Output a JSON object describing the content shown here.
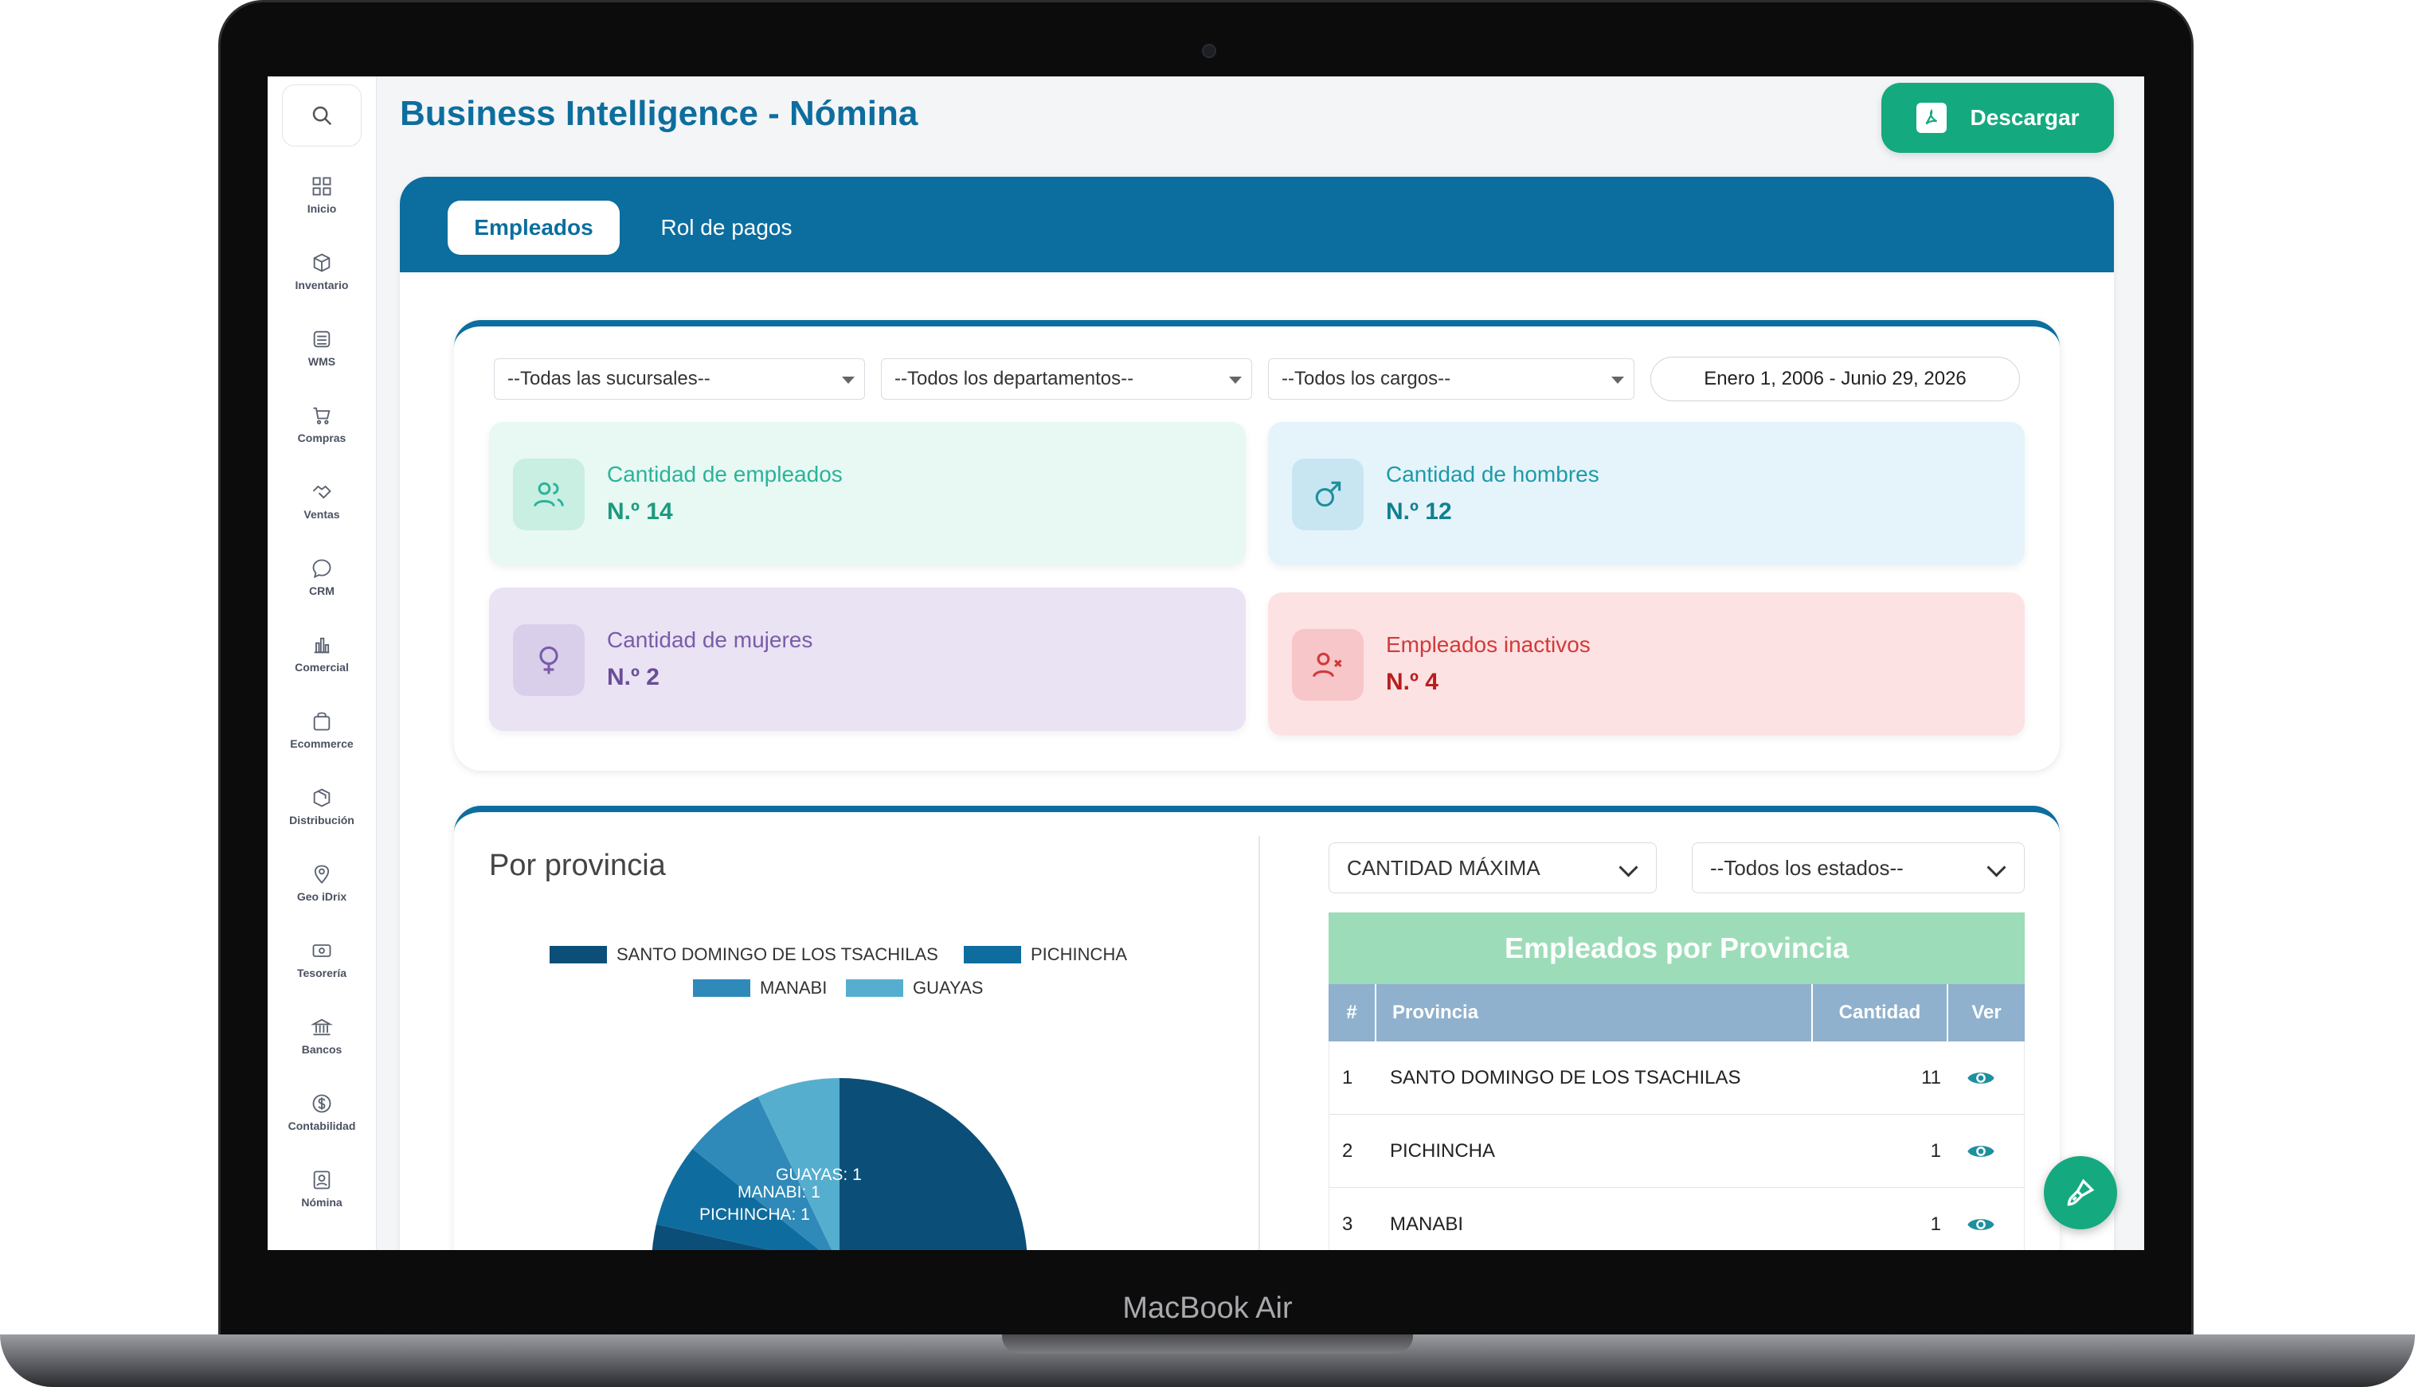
{
  "device": {
    "label": "MacBook Air"
  },
  "sidebar": {
    "items": [
      {
        "label": "Inicio",
        "icon": "grid-icon"
      },
      {
        "label": "Inventario",
        "icon": "box-icon"
      },
      {
        "label": "WMS",
        "icon": "warehouse-icon"
      },
      {
        "label": "Compras",
        "icon": "cart-icon"
      },
      {
        "label": "Ventas",
        "icon": "handshake-icon"
      },
      {
        "label": "CRM",
        "icon": "chat-icon"
      },
      {
        "label": "Comercial",
        "icon": "bar-chart-icon"
      },
      {
        "label": "Ecommerce",
        "icon": "bag-icon"
      },
      {
        "label": "Distribución",
        "icon": "package-icon"
      },
      {
        "label": "Geo iDrix",
        "icon": "map-pin-icon"
      },
      {
        "label": "Tesorería",
        "icon": "cash-icon"
      },
      {
        "label": "Bancos",
        "icon": "bank-icon"
      },
      {
        "label": "Contabilidad",
        "icon": "dollar-icon"
      },
      {
        "label": "Nómina",
        "icon": "badge-icon"
      }
    ]
  },
  "header": {
    "title": "Business Intelligence - Nómina",
    "download_label": "Descargar"
  },
  "tabs": [
    {
      "label": "Empleados",
      "active": true
    },
    {
      "label": "Rol de pagos",
      "active": false
    }
  ],
  "filters": {
    "sucursal": "--Todas las sucursales--",
    "departamento": "--Todos los departamentos--",
    "cargo": "--Todos los cargos--",
    "date_range": "Enero 1, 2006 - Junio 29, 2026"
  },
  "stats": [
    {
      "label": "Cantidad de empleados",
      "value": "N.º 14",
      "color": "#2bb39a"
    },
    {
      "label": "Cantidad de hombres",
      "value": "N.º 12",
      "color": "#1e9aaa"
    },
    {
      "label": "Cantidad de mujeres",
      "value": "N.º 2",
      "color": "#7a5ca8"
    },
    {
      "label": "Empleados inactivos",
      "value": "N.º 4",
      "color": "#d23a3a"
    }
  ],
  "province_section": {
    "title": "Por provincia",
    "metric_select": "CANTIDAD MÁXIMA",
    "state_select": "--Todos los estados--"
  },
  "chart_data": {
    "type": "pie",
    "legend_position": "top",
    "categories": [
      "SANTO DOMINGO DE LOS TSACHILAS",
      "PICHINCHA",
      "MANABI",
      "GUAYAS"
    ],
    "values": [
      11,
      1,
      1,
      1
    ],
    "colors": [
      "#0b4f78",
      "#0f6c9e",
      "#2f8ab9",
      "#56aecf"
    ],
    "data_labels": [
      "",
      "PICHINCHA: 1",
      "MANABI: 1",
      "GUAYAS: 1"
    ]
  },
  "table": {
    "title": "Empleados por Provincia",
    "headers": [
      "#",
      "Provincia",
      "Cantidad",
      "Ver"
    ],
    "rows": [
      {
        "n": "1",
        "provincia": "SANTO DOMINGO DE LOS TSACHILAS",
        "cantidad": "11"
      },
      {
        "n": "2",
        "provincia": "PICHINCHA",
        "cantidad": "1"
      },
      {
        "n": "3",
        "provincia": "MANABI",
        "cantidad": "1"
      }
    ]
  }
}
